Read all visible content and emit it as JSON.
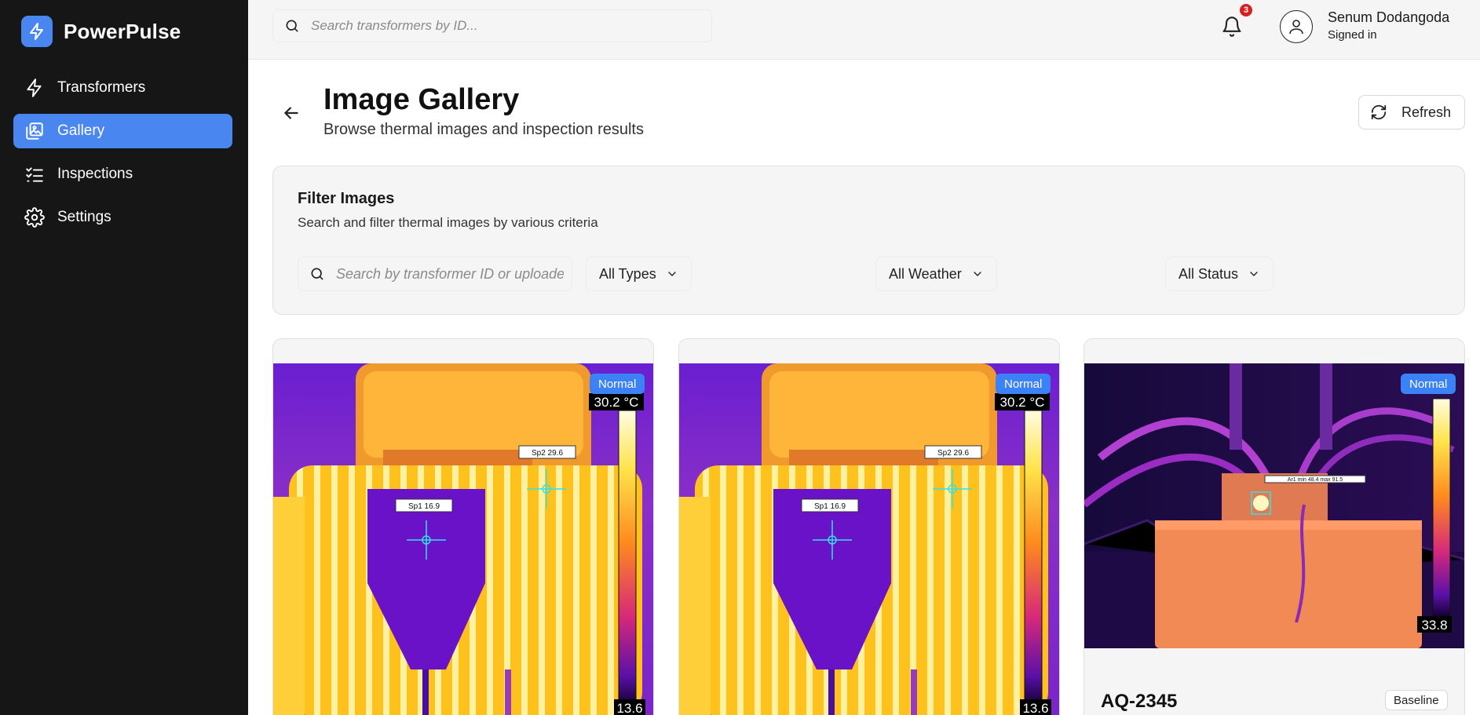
{
  "app": {
    "name": "PowerPulse"
  },
  "sidebar": {
    "items": [
      {
        "label": "Transformers",
        "icon": "lightning-icon",
        "active": false
      },
      {
        "label": "Gallery",
        "icon": "gallery-icon",
        "active": true
      },
      {
        "label": "Inspections",
        "icon": "checklist-icon",
        "active": false
      },
      {
        "label": "Settings",
        "icon": "gear-icon",
        "active": false
      }
    ]
  },
  "topbar": {
    "search_placeholder": "Search transformers by ID...",
    "notifications_count": "3",
    "user_name": "Senum Dodangoda",
    "user_status": "Signed in"
  },
  "header": {
    "title": "Image Gallery",
    "subtitle": "Browse thermal images and inspection results",
    "refresh_label": "Refresh"
  },
  "filter": {
    "title": "Filter Images",
    "subtitle": "Search and filter thermal images by various criteria",
    "search_placeholder": "Search by transformer ID or uploader...",
    "type_selected": "All Types",
    "weather_selected": "All Weather",
    "status_selected": "All Status"
  },
  "cards": [
    {
      "status": "Normal",
      "scale_max": "30.2 °C",
      "scale_min": "13.6",
      "spot1": "Sp1 16.9",
      "spot2": "Sp2 29.6"
    },
    {
      "status": "Normal",
      "scale_max": "30.2 °C",
      "scale_min": "13.6",
      "spot1": "Sp1 16.9",
      "spot2": "Sp2 29.6"
    },
    {
      "status": "Normal",
      "scale_min": "33.8",
      "area_label": "Ar1 min 48.4 max 91.5",
      "transformer_id": "AQ-2345",
      "type": "Baseline"
    }
  ],
  "colors": {
    "accent": "#4a86f0",
    "sidebar_bg": "#161616",
    "badge": "#3b82f6"
  }
}
